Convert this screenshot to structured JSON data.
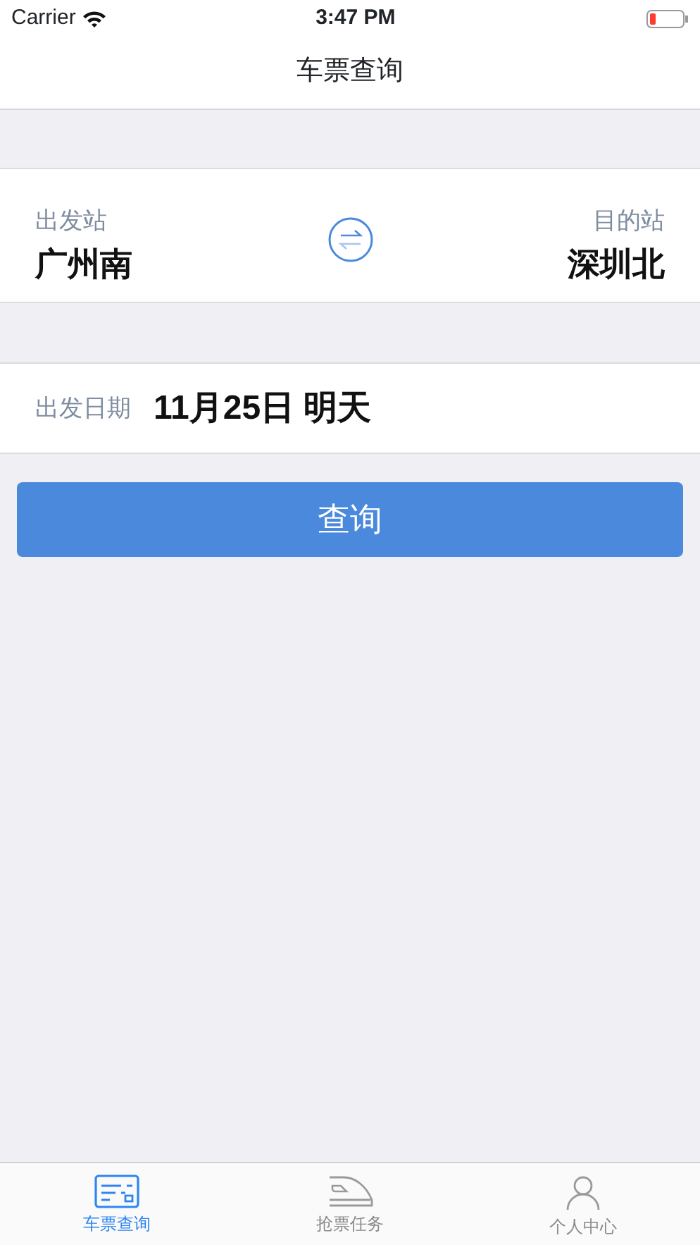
{
  "status_bar": {
    "carrier": "Carrier",
    "time": "3:47 PM",
    "battery_low": true
  },
  "nav": {
    "title": "车票查询"
  },
  "stations": {
    "from_label": "出发站",
    "from": "广州南",
    "to_label": "目的站",
    "to": "深圳北"
  },
  "date": {
    "label": "出发日期",
    "value": "11月25日 明天"
  },
  "search_button": "查询",
  "tabs": [
    {
      "kind": "ticket",
      "label": "车票查询",
      "selected": true
    },
    {
      "kind": "train",
      "label": "抢票任务",
      "selected": false
    },
    {
      "kind": "person",
      "label": "个人中心",
      "selected": false
    }
  ]
}
